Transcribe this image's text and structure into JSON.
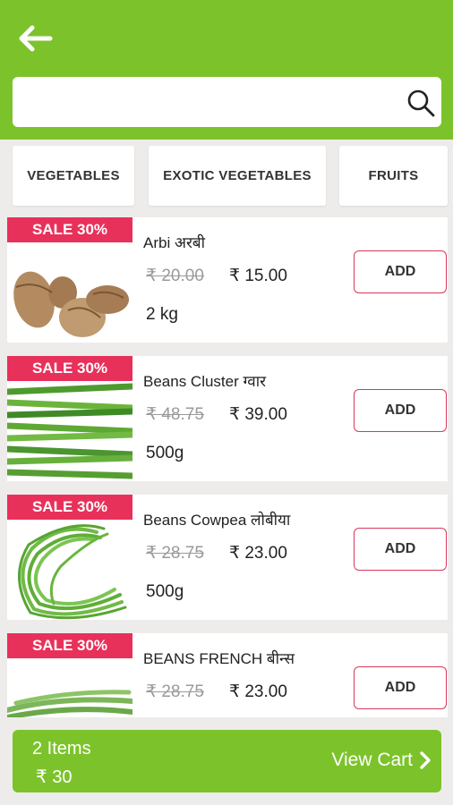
{
  "colors": {
    "brand_green": "#7cc32b",
    "sale_red": "#e8315a",
    "add_border": "#d7385c"
  },
  "header": {
    "back_icon": "arrow-left-icon"
  },
  "search": {
    "value": "",
    "placeholder": "",
    "icon": "search-icon"
  },
  "categories": [
    {
      "label": "VEGETABLES"
    },
    {
      "label": "EXOTIC VEGETABLES"
    },
    {
      "label": "FRUITS"
    }
  ],
  "products": [
    {
      "sale": "SALE 30%",
      "name": "Arbi अरबी",
      "mrp": "₹ 20.00",
      "price": "₹ 15.00",
      "qty": "2 kg",
      "add_label": "ADD"
    },
    {
      "sale": "SALE 30%",
      "name": "Beans Cluster  ग्वार",
      "mrp": "₹ 48.75",
      "price": "₹ 39.00",
      "qty": "500g",
      "add_label": "ADD"
    },
    {
      "sale": "SALE 30%",
      "name": "Beans Cowpea लोबीया",
      "mrp": "₹ 28.75",
      "price": "₹ 23.00",
      "qty": "500g",
      "add_label": "ADD"
    },
    {
      "sale": "SALE 30%",
      "name": "BEANS FRENCH  बीन्स",
      "mrp": "₹ 28.75",
      "price": "₹ 23.00",
      "qty": "",
      "add_label": "ADD"
    }
  ],
  "cart": {
    "items": "2 Items",
    "total": "₹ 30",
    "view_label": "View Cart",
    "chevron_icon": "chevron-right-icon"
  }
}
